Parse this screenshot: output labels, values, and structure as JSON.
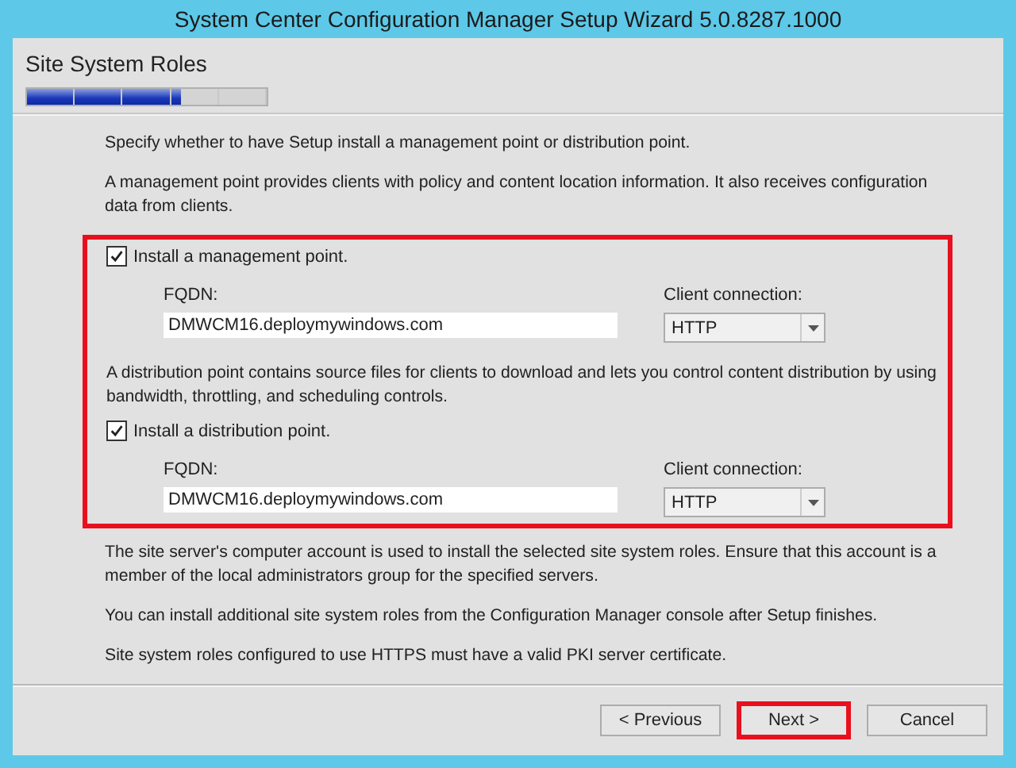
{
  "window": {
    "title": "System Center Configuration Manager Setup Wizard 5.0.8287.1000"
  },
  "page": {
    "title": "Site System Roles",
    "progress": {
      "level": 0.64
    }
  },
  "intro": [
    "Specify whether to have Setup install a management point or distribution point.",
    "A management point provides clients with policy and content location information. It also receives configuration data from clients."
  ],
  "roles": {
    "highlighted": true,
    "items": [
      {
        "checkbox_label": "Install a management point.",
        "checked": true,
        "fqdn_label": "FQDN:",
        "fqdn_value": "DMWCM16.deploymywindows.com",
        "connection_label": "Client connection:",
        "connection_value": "HTTP"
      },
      {
        "description": "A distribution point contains source files for clients to download and lets you control content distribution by using bandwidth, throttling, and scheduling controls.",
        "checkbox_label": "Install a distribution point.",
        "checked": true,
        "fqdn_label": "FQDN:",
        "fqdn_value": "DMWCM16.deploymywindows.com",
        "connection_label": "Client connection:",
        "connection_value": "HTTP"
      }
    ]
  },
  "notes": [
    "The site server's computer account is used to install the selected site system roles. Ensure that this account is a member of the local administrators group for the specified servers.",
    "You can install additional site system roles from the Configuration Manager console after Setup finishes.",
    "Site system roles configured to use HTTPS must have a valid PKI server certificate."
  ],
  "buttons": [
    {
      "label": "< Previous",
      "highlighted": false
    },
    {
      "label": "Next >",
      "highlighted": true
    },
    {
      "label": "Cancel",
      "highlighted": false
    }
  ]
}
